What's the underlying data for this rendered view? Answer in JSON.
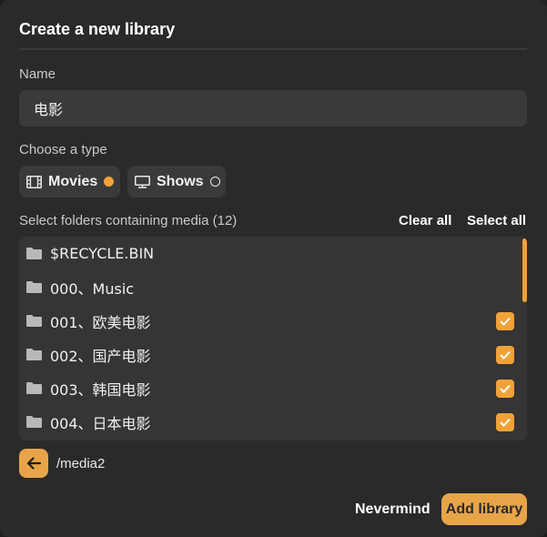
{
  "dialog": {
    "title": "Create a new library",
    "name_label": "Name",
    "name_value": "电影",
    "type_label": "Choose a type",
    "types": [
      {
        "label": "Movies",
        "icon": "film-icon",
        "selected": true
      },
      {
        "label": "Shows",
        "icon": "tv-icon",
        "selected": false
      }
    ],
    "folders_label": "Select folders containing media (12)",
    "clear_all": "Clear all",
    "select_all": "Select all",
    "folders": [
      {
        "name": "$RECYCLE.BIN",
        "checked": false
      },
      {
        "name": "000、Music",
        "checked": false
      },
      {
        "name": "001、欧美电影",
        "checked": true
      },
      {
        "name": "002、国产电影",
        "checked": true
      },
      {
        "name": "003、韩国电影",
        "checked": true
      },
      {
        "name": "004、日本电影",
        "checked": true
      }
    ],
    "current_path": "/media2",
    "cancel_label": "Nevermind",
    "submit_label": "Add library"
  },
  "colors": {
    "accent": "#f0a23a",
    "button": "#e8a449",
    "panel": "#2a2a2a",
    "field": "#3a3a3a"
  }
}
